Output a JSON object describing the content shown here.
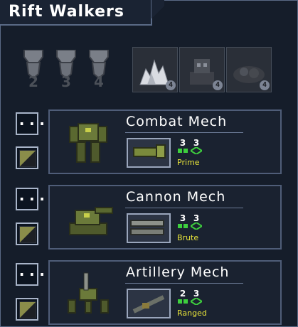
{
  "squad": {
    "title": "Rift Walkers"
  },
  "medals": [
    "2",
    "3",
    "4"
  ],
  "pilots": [
    {
      "icon": "crystal-pilot-icon",
      "status": "locked"
    },
    {
      "icon": "robot-pilot-icon",
      "status": "locked"
    },
    {
      "icon": "rubble-pilot-icon",
      "status": "locked"
    }
  ],
  "mechs": [
    {
      "name": "Combat Mech",
      "move": "3",
      "armor": "3",
      "class": "Prime",
      "weapon_icon": "titan-fist-icon"
    },
    {
      "name": "Cannon Mech",
      "move": "3",
      "armor": "3",
      "class": "Brute",
      "weapon_icon": "taurus-cannon-icon"
    },
    {
      "name": "Artillery Mech",
      "move": "2",
      "armor": "3",
      "class": "Ranged",
      "weapon_icon": "artemis-artillery-icon"
    }
  ],
  "buttons": {
    "options": "..."
  },
  "colors": {
    "accent": "#e8e43a",
    "move": "#3ecf3e",
    "armor": "#3ecf3e",
    "frame": "#4f5d78"
  }
}
